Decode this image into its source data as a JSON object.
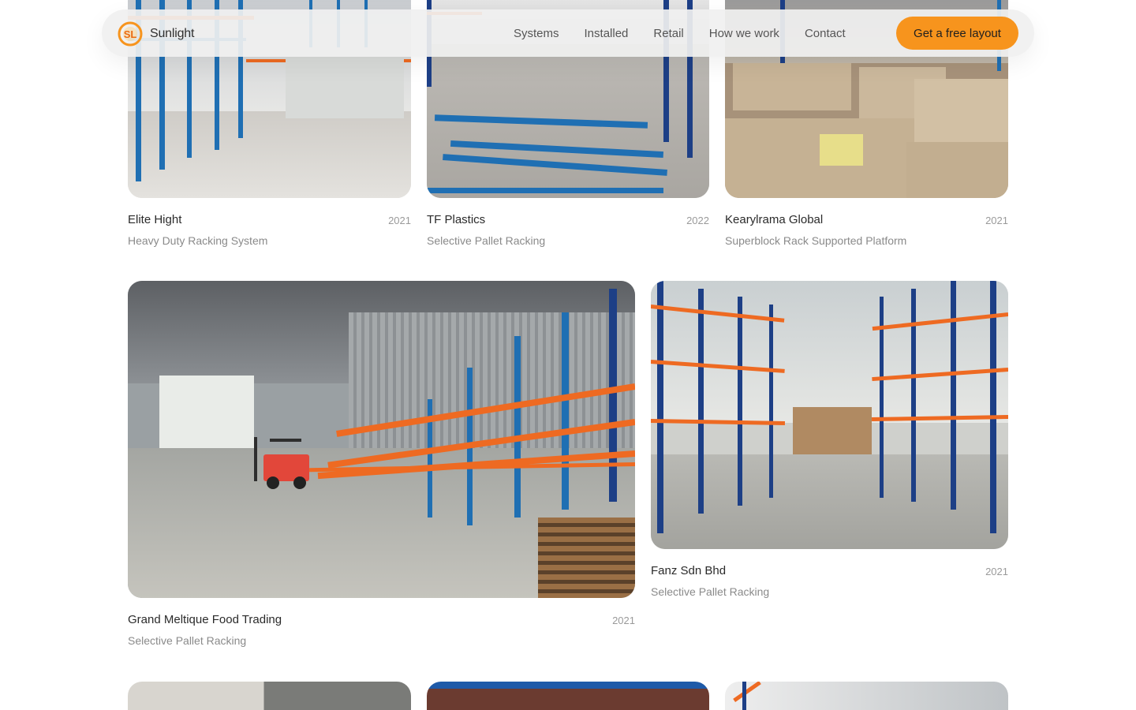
{
  "brand": {
    "name": "Sunlight",
    "logo_icon": "sunlight-logo-icon",
    "logo_letters": "SL"
  },
  "nav": {
    "links": [
      "Systems",
      "Installed",
      "Retail",
      "How we work",
      "Contact"
    ],
    "cta": "Get a free layout"
  },
  "colors": {
    "accent": "#f7941d",
    "upright_blue": "#1f6fb3",
    "beam_orange": "#ee6a22"
  },
  "projects": [
    {
      "name": "Elite Hight",
      "year": "2021",
      "type": "Heavy Duty Racking System"
    },
    {
      "name": "TF Plastics",
      "year": "2022",
      "type": "Selective Pallet Racking"
    },
    {
      "name": "Kearylrama Global",
      "year": "2021",
      "type": "Superblock Rack Supported Platform"
    },
    {
      "name": "Grand Meltique Food Trading",
      "year": "2021",
      "type": "Selective Pallet Racking"
    },
    {
      "name": "Fanz Sdn Bhd",
      "year": "2021",
      "type": "Selective Pallet Racking"
    }
  ]
}
